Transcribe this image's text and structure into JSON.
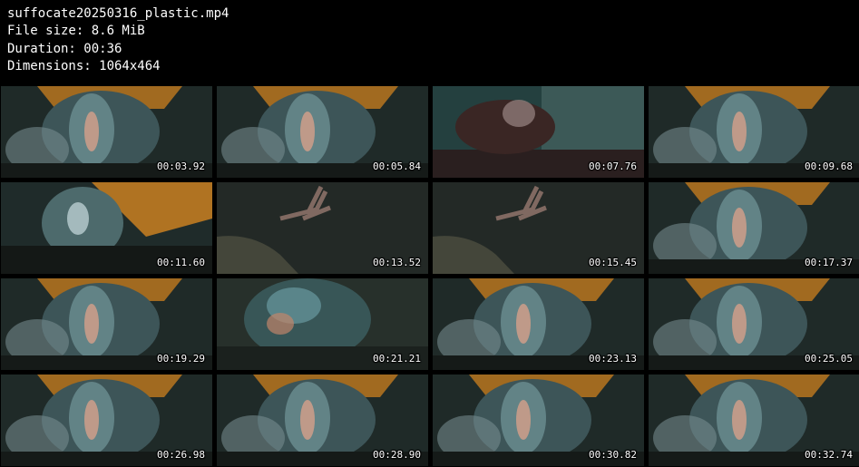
{
  "header": {
    "filename": "suffocate20250316_plastic.mp4",
    "filesize": "File size: 8.6 MiB",
    "duration": "Duration: 00:36",
    "dimensions": "Dimensions: 1064x464"
  },
  "thumbnails": [
    {
      "time": "00:03.92",
      "scene": "orange-top"
    },
    {
      "time": "00:05.84",
      "scene": "orange-top"
    },
    {
      "time": "00:07.76",
      "scene": "room"
    },
    {
      "time": "00:09.68",
      "scene": "orange-top"
    },
    {
      "time": "00:11.60",
      "scene": "orange-left"
    },
    {
      "time": "00:13.52",
      "scene": "dark-hand"
    },
    {
      "time": "00:15.45",
      "scene": "dark-hand"
    },
    {
      "time": "00:17.37",
      "scene": "orange-top"
    },
    {
      "time": "00:19.29",
      "scene": "orange-top"
    },
    {
      "time": "00:21.21",
      "scene": "teal-face"
    },
    {
      "time": "00:23.13",
      "scene": "orange-top"
    },
    {
      "time": "00:25.05",
      "scene": "orange-top"
    },
    {
      "time": "00:26.98",
      "scene": "orange-top"
    },
    {
      "time": "00:28.90",
      "scene": "orange-top"
    },
    {
      "time": "00:30.82",
      "scene": "orange-top"
    },
    {
      "time": "00:32.74",
      "scene": "orange-top"
    }
  ],
  "colors": {
    "background": "#000000",
    "text": "#ffffff",
    "teal": "#2f5d5c",
    "orange": "#b8761e",
    "dark": "#1a1f1c"
  }
}
